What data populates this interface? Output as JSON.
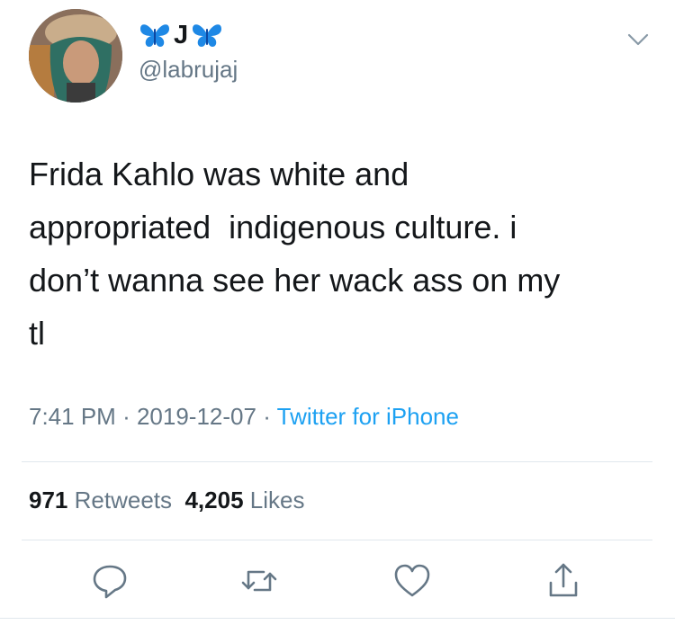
{
  "tweet": {
    "display_name_letter": "J",
    "name_emoji": "blue-butterfly-icon",
    "handle": "@labrujaj",
    "text": "Frida Kahlo was white and\nappropriated  indigenous culture. i\ndon’t wanna see her wack ass on my\ntl",
    "time": "7:41 PM",
    "separator": "·",
    "date": "2019-12-07",
    "source": "Twitter for iPhone",
    "retweets_count": "971",
    "retweets_label": "Retweets",
    "likes_count": "4,205",
    "likes_label": "Likes"
  },
  "icons": {
    "menu": "chevron-down-icon",
    "reply": "reply-icon",
    "retweet": "retweet-icon",
    "like": "heart-icon",
    "share": "share-icon"
  },
  "colors": {
    "text": "#14171a",
    "secondary": "#657786",
    "link": "#1da1f2",
    "divider": "#e1e8ed",
    "butterfly": "#1e88e5"
  }
}
